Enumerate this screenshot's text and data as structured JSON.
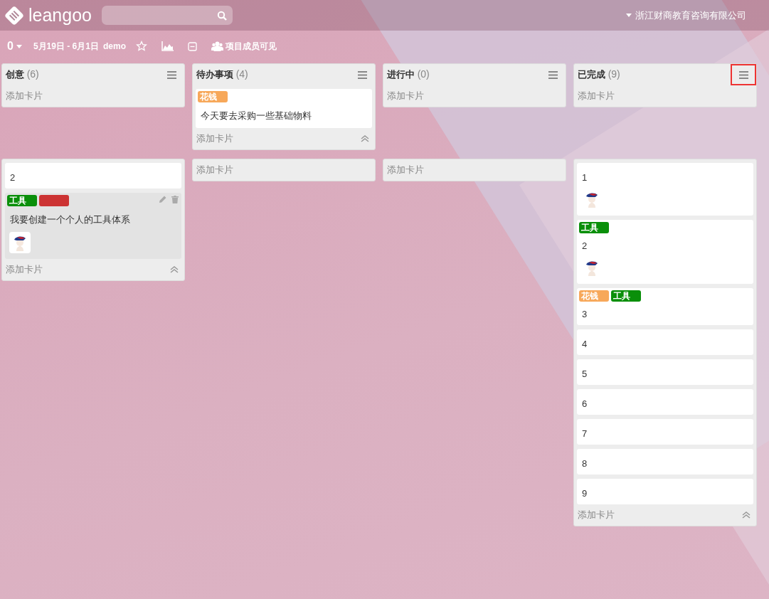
{
  "header": {
    "logo": "leangoo",
    "org": "浙江财商教育咨询有限公司"
  },
  "toolbar": {
    "count": "0",
    "dates": "5月19日 - 6月1日",
    "board": "demo",
    "starred": false,
    "visibility": "项目成员可见"
  },
  "lanes": [
    {
      "lists": [
        {
          "title": "创意",
          "count": "(6)",
          "menu_highlighted": false,
          "add": "添加卡片"
        },
        {
          "title": "待办事项",
          "count": "(4)",
          "menu_highlighted": false,
          "cards": [
            {
              "labels": [
                {
                  "text": "花钱",
                  "color": "#f7a85a"
                }
              ],
              "title": "今天要去采购一些基础物料",
              "avatar": false,
              "hovered": false
            }
          ],
          "add": "添加卡片"
        },
        {
          "title": "进行中",
          "count": "(0)",
          "menu_highlighted": false,
          "add": "添加卡片"
        },
        {
          "title": "已完成",
          "count": "(9)",
          "menu_highlighted": true,
          "add": "添加卡片"
        }
      ]
    },
    {
      "lists": [
        {
          "cards": [
            {
              "title": "2",
              "avatar": false,
              "hovered": false
            },
            {
              "labels": [
                {
                  "text": "工具",
                  "color": "#0a8f0a"
                },
                {
                  "color": "#cc3333"
                }
              ],
              "title": "我要创建一个个人的工具体系",
              "avatar": true,
              "hovered": true
            }
          ],
          "add": "添加卡片"
        },
        {
          "add": "添加卡片"
        },
        {
          "add": "添加卡片"
        },
        {
          "cards": [
            {
              "title": "1",
              "avatar": true,
              "hovered": false
            },
            {
              "labels": [
                {
                  "text": "工具",
                  "color": "#0a8f0a"
                }
              ],
              "title": "2",
              "avatar": true,
              "hovered": false
            },
            {
              "labels": [
                {
                  "text": "花钱",
                  "color": "#f7a85a"
                },
                {
                  "text": "工具",
                  "color": "#0a8f0a"
                }
              ],
              "title": "3",
              "avatar": false,
              "hovered": false
            },
            {
              "title": "4",
              "avatar": false,
              "hovered": false
            },
            {
              "title": "5",
              "avatar": false,
              "hovered": false
            },
            {
              "title": "6",
              "avatar": false,
              "hovered": false
            },
            {
              "title": "7",
              "avatar": false,
              "hovered": false
            },
            {
              "title": "8",
              "avatar": false,
              "hovered": false
            },
            {
              "title": "9",
              "avatar": false,
              "hovered": false
            }
          ],
          "add": "添加卡片"
        }
      ]
    }
  ]
}
